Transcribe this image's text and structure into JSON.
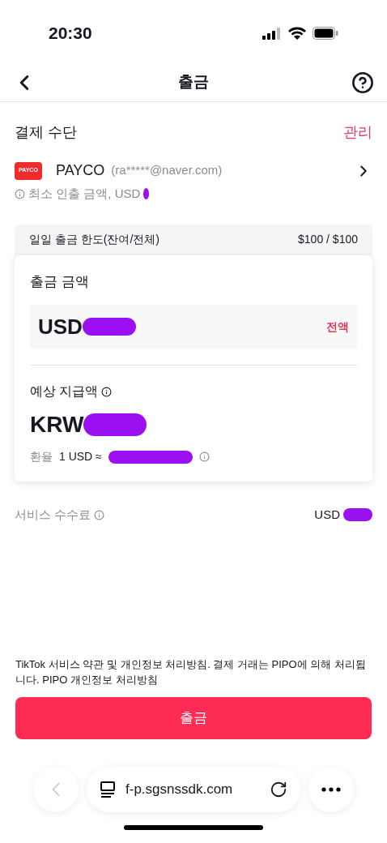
{
  "status_bar": {
    "time": "20:30"
  },
  "header": {
    "title": "출금"
  },
  "payment": {
    "heading": "결제 수단",
    "manage": "관리",
    "method": "PAYCO",
    "logo": "PAYCO",
    "account": "(ra*****@naver.com)",
    "minimum": "최소 인출 금액, USD"
  },
  "limit": {
    "label": "일일 출금 한도(잔여/전체)",
    "value": "$100 / $100"
  },
  "amount": {
    "label": "출금 금액",
    "currency": "USD",
    "all": "전액"
  },
  "estimate": {
    "label": "예상 지급액",
    "currency": "KRW",
    "rate_label": "환율",
    "rate": "1 USD ≈"
  },
  "fee": {
    "label": "서비스 수수료",
    "currency": "USD"
  },
  "terms": "TikTok 서비스 약관 및 개인정보 처리방침. 결제 거래는 PIPO에 의해 처리됩니다. PIPO 개인정보 처리방침",
  "submit": "출금",
  "browser": {
    "url": "f-p.sgsnssdk.com"
  }
}
